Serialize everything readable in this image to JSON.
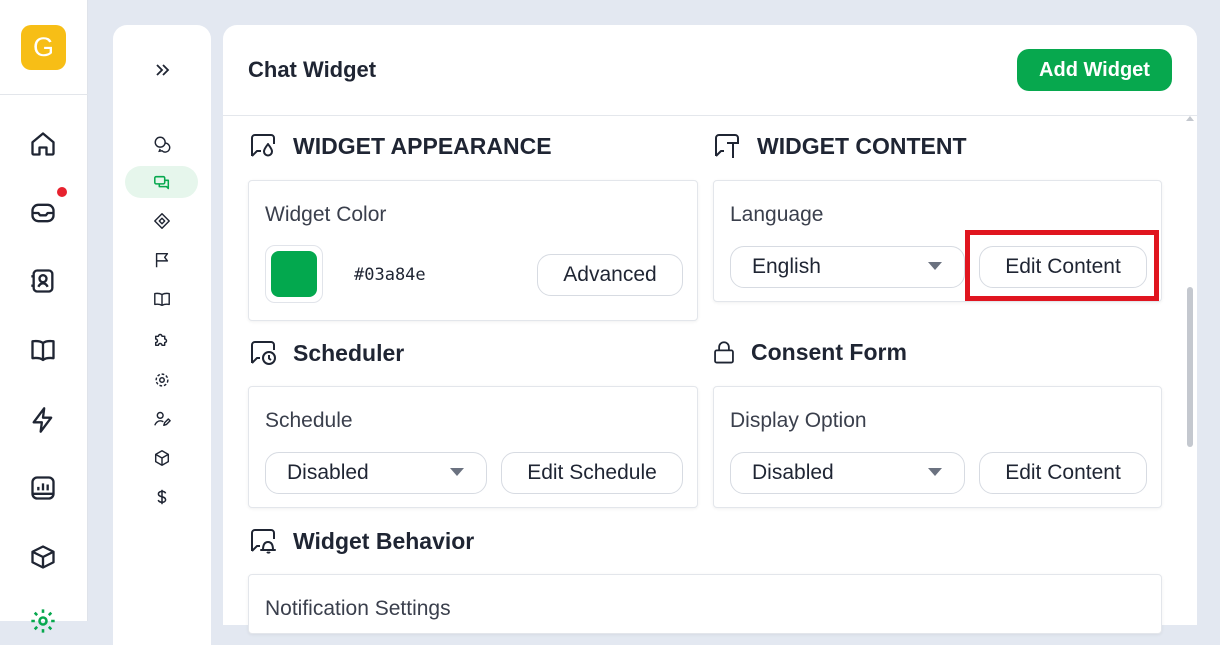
{
  "app": {
    "logo_letter": "G"
  },
  "rail": {
    "items": [
      {
        "name": "home-icon"
      },
      {
        "name": "inbox-icon",
        "has_notification": true
      },
      {
        "name": "contacts-icon"
      },
      {
        "name": "book-icon"
      },
      {
        "name": "lightning-icon"
      },
      {
        "name": "reports-icon"
      },
      {
        "name": "box-icon"
      },
      {
        "name": "settings-icon"
      }
    ],
    "accent_color": "#07a84e",
    "notification_color": "#e7222e"
  },
  "subnav": {
    "items": [
      {
        "name": "chat-bubbles-icon"
      },
      {
        "name": "chat-widget-icon",
        "active": true
      },
      {
        "name": "tag-icon"
      },
      {
        "name": "flag-icon"
      },
      {
        "name": "book-icon"
      },
      {
        "name": "puzzle-icon"
      },
      {
        "name": "gear-icon"
      },
      {
        "name": "user-edit-icon"
      },
      {
        "name": "cube-icon"
      },
      {
        "name": "dollar-icon"
      }
    ]
  },
  "header": {
    "title": "Chat Widget",
    "add_button": "Add Widget"
  },
  "sections": {
    "appearance": {
      "title": "WIDGET APPEARANCE",
      "label": "Widget Color",
      "color_value": "#03a84e",
      "advanced_button": "Advanced"
    },
    "content": {
      "title": "WIDGET CONTENT",
      "label": "Language",
      "language_value": "English",
      "edit_button": "Edit Content"
    },
    "scheduler": {
      "title": "Scheduler",
      "label": "Schedule",
      "schedule_value": "Disabled",
      "edit_button": "Edit Schedule"
    },
    "consent": {
      "title": "Consent Form",
      "label": "Display Option",
      "display_value": "Disabled",
      "edit_button": "Edit Content"
    },
    "behavior": {
      "title": "Widget Behavior",
      "label": "Notification Settings"
    }
  }
}
